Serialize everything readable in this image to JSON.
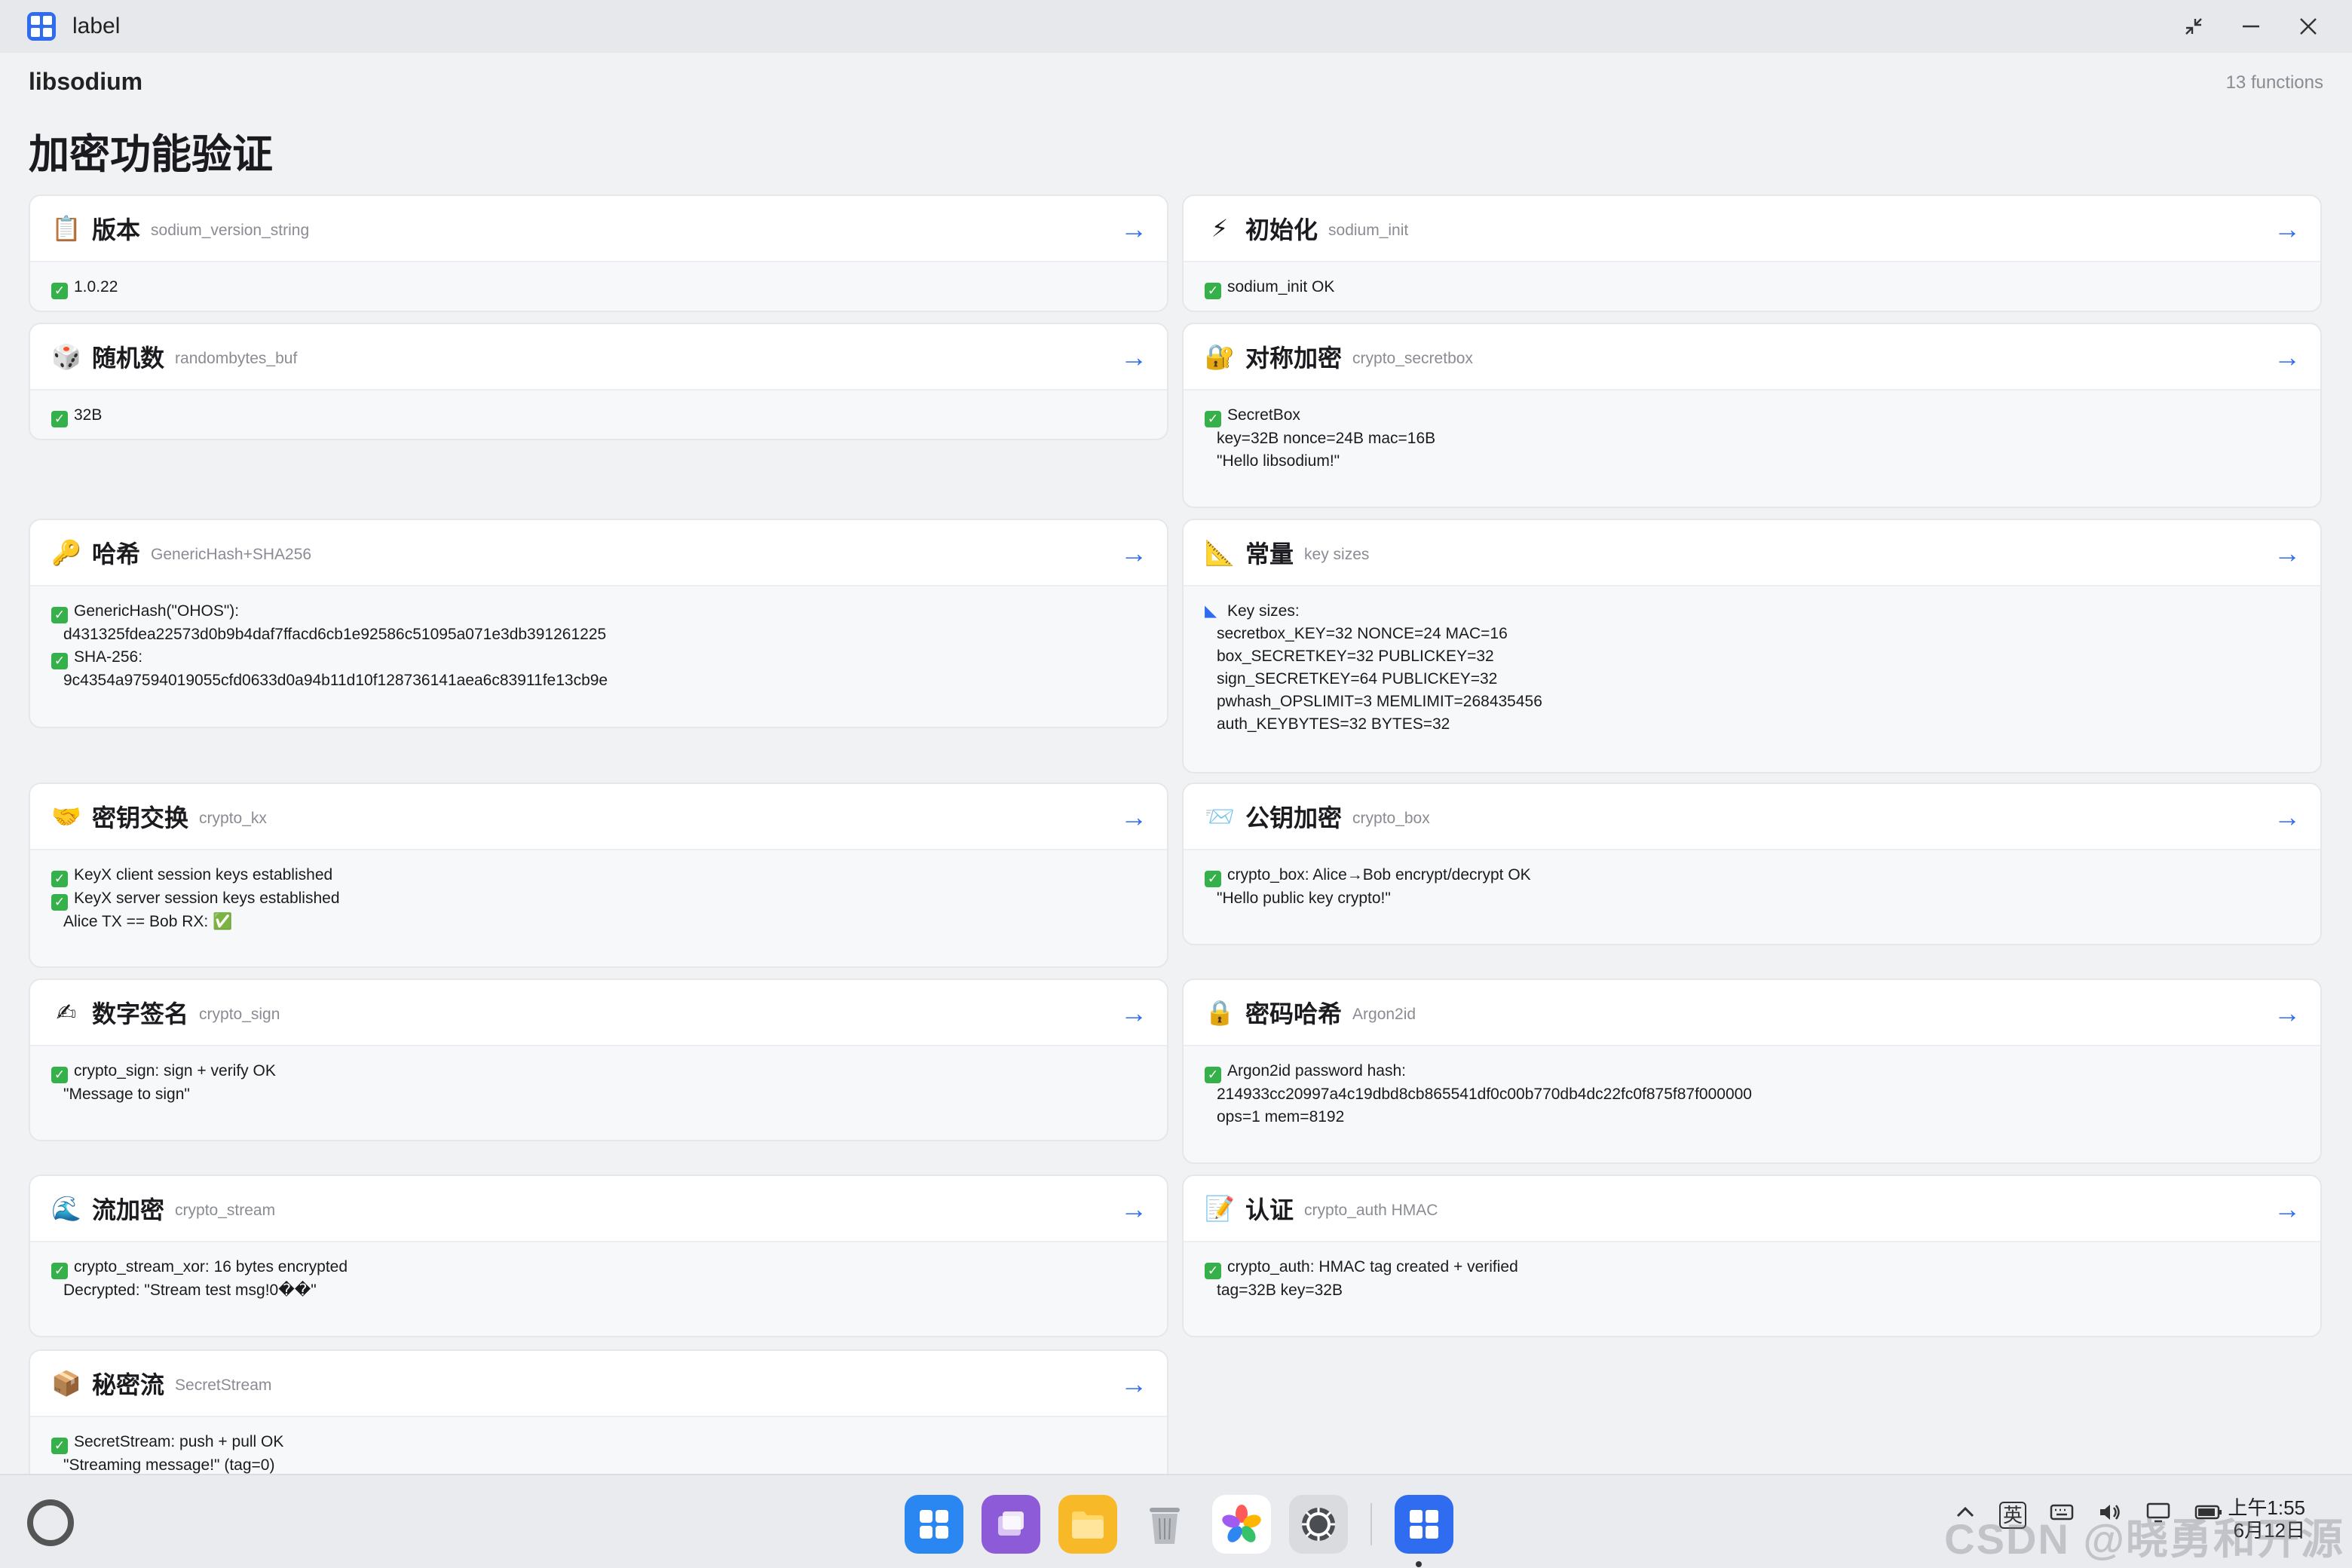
{
  "window": {
    "title": "label",
    "controls": [
      "restore",
      "minimize",
      "close"
    ]
  },
  "header": {
    "library": "libsodium",
    "function_count": "13 functions",
    "page_title": "加密功能验证"
  },
  "cards": [
    {
      "emoji": "📋",
      "title": "版本",
      "subtitle": "sodium_version_string",
      "lines": [
        {
          "icon": "check",
          "text": "1.0.22"
        }
      ]
    },
    {
      "emoji": "⚡",
      "title": "初始化",
      "subtitle": "sodium_init",
      "lines": [
        {
          "icon": "check",
          "text": "sodium_init OK"
        }
      ]
    },
    {
      "emoji": "🎲",
      "title": "随机数",
      "subtitle": "randombytes_buf",
      "lines": [
        {
          "icon": "check",
          "text": "32B"
        }
      ]
    },
    {
      "emoji": "🔐",
      "title": "对称加密",
      "subtitle": "crypto_secretbox",
      "lines": [
        {
          "icon": "check",
          "text": "SecretBox"
        },
        {
          "icon": "",
          "text": "key=32B nonce=24B mac=16B"
        },
        {
          "icon": "",
          "text": "\"Hello libsodium!\""
        }
      ]
    },
    {
      "emoji": "🔑",
      "title": "哈希",
      "subtitle": "GenericHash+SHA256",
      "lines": [
        {
          "icon": "check",
          "text": "GenericHash(\"OHOS\"):"
        },
        {
          "icon": "",
          "text": "d431325fdea22573d0b9b4daf7ffacd6cb1e92586c51095a071e3db391261225"
        },
        {
          "icon": "check",
          "text": "SHA-256:"
        },
        {
          "icon": "",
          "text": "9c4354a97594019055cfd0633d0a94b11d10f128736141aea6c83911fe13cb9e"
        }
      ]
    },
    {
      "emoji": "📐",
      "title": "常量",
      "subtitle": "key sizes",
      "lines": [
        {
          "icon": "ruler",
          "text": "Key sizes:"
        },
        {
          "icon": "",
          "text": "secretbox_KEY=32 NONCE=24 MAC=16"
        },
        {
          "icon": "",
          "text": "box_SECRETKEY=32 PUBLICKEY=32"
        },
        {
          "icon": "",
          "text": "sign_SECRETKEY=64 PUBLICKEY=32"
        },
        {
          "icon": "",
          "text": "pwhash_OPSLIMIT=3 MEMLIMIT=268435456"
        },
        {
          "icon": "",
          "text": "auth_KEYBYTES=32 BYTES=32"
        }
      ]
    },
    {
      "emoji": "🤝",
      "title": "密钥交换",
      "subtitle": "crypto_kx",
      "lines": [
        {
          "icon": "check",
          "text": "KeyX client session keys established"
        },
        {
          "icon": "check",
          "text": "KeyX server session keys established"
        },
        {
          "icon": "",
          "text": "Alice TX == Bob RX: ✅"
        }
      ]
    },
    {
      "emoji": "📨",
      "title": "公钥加密",
      "subtitle": "crypto_box",
      "lines": [
        {
          "icon": "check",
          "text": "crypto_box: Alice→Bob encrypt/decrypt OK"
        },
        {
          "icon": "",
          "text": "\"Hello public key crypto!\""
        }
      ]
    },
    {
      "emoji": "✍",
      "title": "数字签名",
      "subtitle": "crypto_sign",
      "lines": [
        {
          "icon": "check",
          "text": "crypto_sign: sign + verify OK"
        },
        {
          "icon": "",
          "text": "\"Message to sign\""
        }
      ]
    },
    {
      "emoji": "🔒",
      "title": "密码哈希",
      "subtitle": "Argon2id",
      "lines": [
        {
          "icon": "check",
          "text": "Argon2id password hash:"
        },
        {
          "icon": "",
          "text": "214933cc20997a4c19dbd8cb865541df0c00b770db4dc22fc0f875f87f000000"
        },
        {
          "icon": "",
          "text": "ops=1 mem=8192"
        }
      ]
    },
    {
      "emoji": "🌊",
      "title": "流加密",
      "subtitle": "crypto_stream",
      "lines": [
        {
          "icon": "check",
          "text": "crypto_stream_xor: 16 bytes encrypted"
        },
        {
          "icon": "",
          "text": "Decrypted: \"Stream test msg!0��\""
        }
      ]
    },
    {
      "emoji": "📝",
      "title": "认证",
      "subtitle": "crypto_auth HMAC",
      "lines": [
        {
          "icon": "check",
          "text": "crypto_auth: HMAC tag created + verified"
        },
        {
          "icon": "",
          "text": "tag=32B key=32B"
        }
      ]
    },
    {
      "emoji": "📦",
      "title": "秘密流",
      "subtitle": "SecretStream",
      "lines": [
        {
          "icon": "check",
          "text": "SecretStream: push + pull OK"
        },
        {
          "icon": "",
          "text": "\"Streaming message!\" (tag=0)"
        }
      ]
    }
  ],
  "taskbar": {
    "dock_apps": [
      "app-center-icon",
      "multitask-icon",
      "files-icon",
      "trash-icon",
      "photos-icon",
      "settings-icon",
      "label-app-icon"
    ],
    "tray_ime": "英",
    "clock_time": "上午1:55",
    "clock_date": "6月12日",
    "watermark": "CSDN @晓勇和开源"
  }
}
